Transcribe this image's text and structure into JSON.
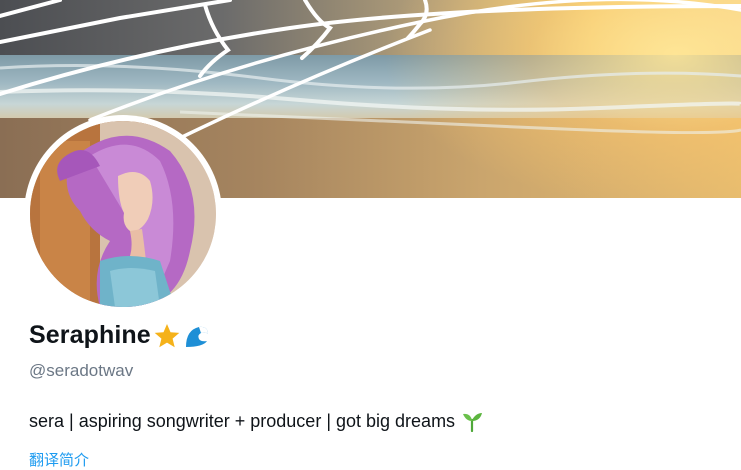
{
  "profile": {
    "display_name": "Seraphine",
    "name_emojis": [
      "star-emoji",
      "wave-emoji"
    ],
    "handle": "@seradotwav",
    "bio": "sera | aspiring songwriter + producer | got big dreams",
    "bio_emoji": "seedling-emoji",
    "translate_label": "翻译简介"
  },
  "colors": {
    "text_primary": "#0f1419",
    "text_secondary": "#6b7785",
    "link": "#1d9bf0"
  }
}
